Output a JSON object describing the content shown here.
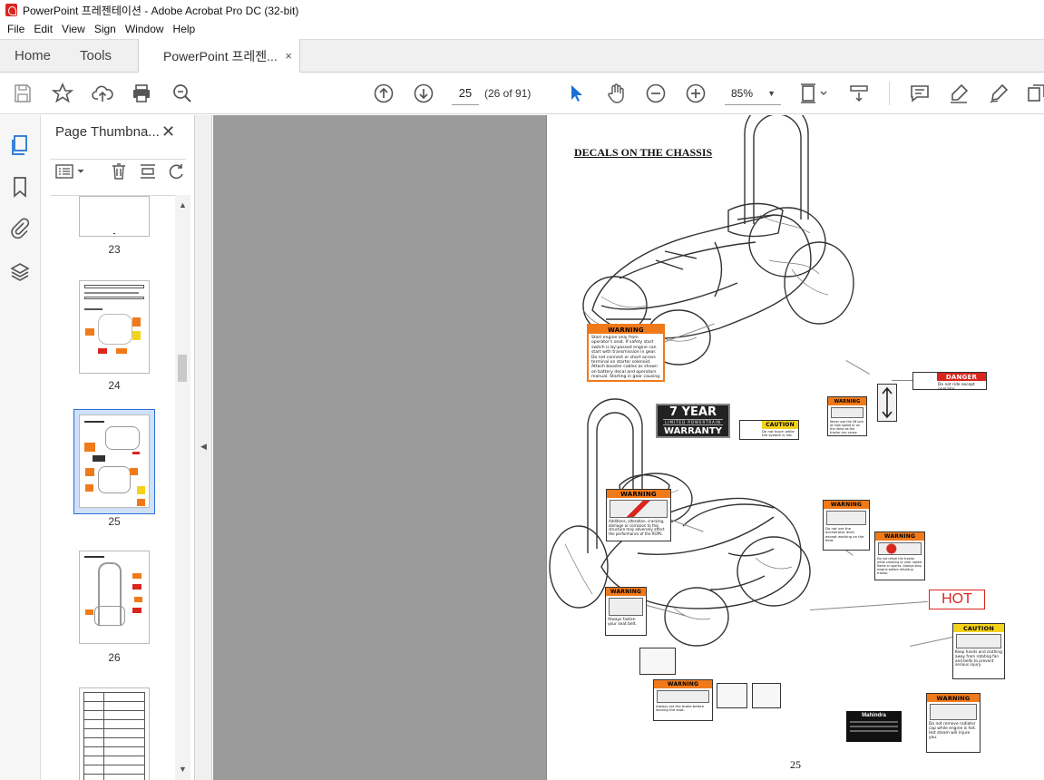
{
  "window": {
    "title": "PowerPoint 프레젠테이션 - Adobe Acrobat Pro DC (32-bit)"
  },
  "menu": [
    "File",
    "Edit",
    "View",
    "Sign",
    "Window",
    "Help"
  ],
  "tabs": {
    "home": "Home",
    "tools": "Tools",
    "document": "PowerPoint 프레젠...",
    "close": "×"
  },
  "toolbar": {
    "icons": [
      "save-icon",
      "star-icon",
      "upload-icon",
      "print-icon",
      "search-zoom-icon",
      "page-up-icon",
      "page-down-icon",
      "select-cursor-icon",
      "hand-icon",
      "zoom-out-icon",
      "zoom-in-icon",
      "page-fit-icon",
      "scroll-mode-icon",
      "comment-icon",
      "highlight-icon",
      "sign-icon",
      "more-tools-icon"
    ],
    "current_page": "25",
    "page_count": "(26 of 91)",
    "zoom": "85%"
  },
  "sidebar": {
    "title": "Page Thumbna...",
    "close": "✕",
    "thumbnails": [
      {
        "label": "23",
        "selected": false
      },
      {
        "label": "24",
        "selected": false
      },
      {
        "label": "25",
        "selected": true
      },
      {
        "label": "26",
        "selected": false
      },
      {
        "label": "",
        "selected": false
      }
    ]
  },
  "document": {
    "heading": "DECALS ON THE CHASSIS",
    "page_number": "25",
    "warranty": {
      "line1": "7 YEAR",
      "line2": "LIMITED POWERTRAIN",
      "line3": "WARRANTY"
    },
    "hot_label": "HOT",
    "plate_brand": "Mahindra",
    "decals": {
      "warning_start": {
        "header": "WARNING",
        "text": "Start engine only from operator's seat. If safety start switch is by-passed engine can start with transmission in gear. Do not connect or short across terminal on starter solenoid. Attach booster cables as shown on battery decal and operators manual. Starting in gear causing runaway can result in serious injury."
      },
      "danger_ride": {
        "header": "DANGER",
        "text": "Do not ride except operator."
      },
      "warning_lift": {
        "header": "WARNING",
        "text": "Never use the lift lock at high speed or on the ramp as the tractor can cause serious injury."
      },
      "caution_touch": {
        "header": "CAUTION",
        "text": "Do not touch while the system is hot."
      },
      "warning_rops": {
        "header": "WARNING",
        "text": "Additions, alteration, cracking, damage or corrosion to this structure may adversely affect the performance of the ROPS."
      },
      "warning_accel": {
        "header": "WARNING",
        "text": "Do not use the accelerator lever except working on the field."
      },
      "warning_refuel": {
        "header": "WARNING",
        "text": "Do not refuel the tractor while smoking or near naked flame or sparks. Always stop engine before refueling tractor."
      },
      "warning_belt": {
        "header": "WARNING",
        "text": "Always fasten your seat belt."
      },
      "caution_fan": {
        "header": "CAUTION",
        "text": "Keep hands and clothing away from rotating fan and belts to prevent serious injury."
      },
      "warning_brake": {
        "header": "WARNING",
        "text": "Always set the brake before leaving the seat."
      },
      "warning_radiator": {
        "header": "WARNING",
        "text": "Do not remove radiator cap while engine is hot. Hot steam will injure you."
      }
    }
  }
}
